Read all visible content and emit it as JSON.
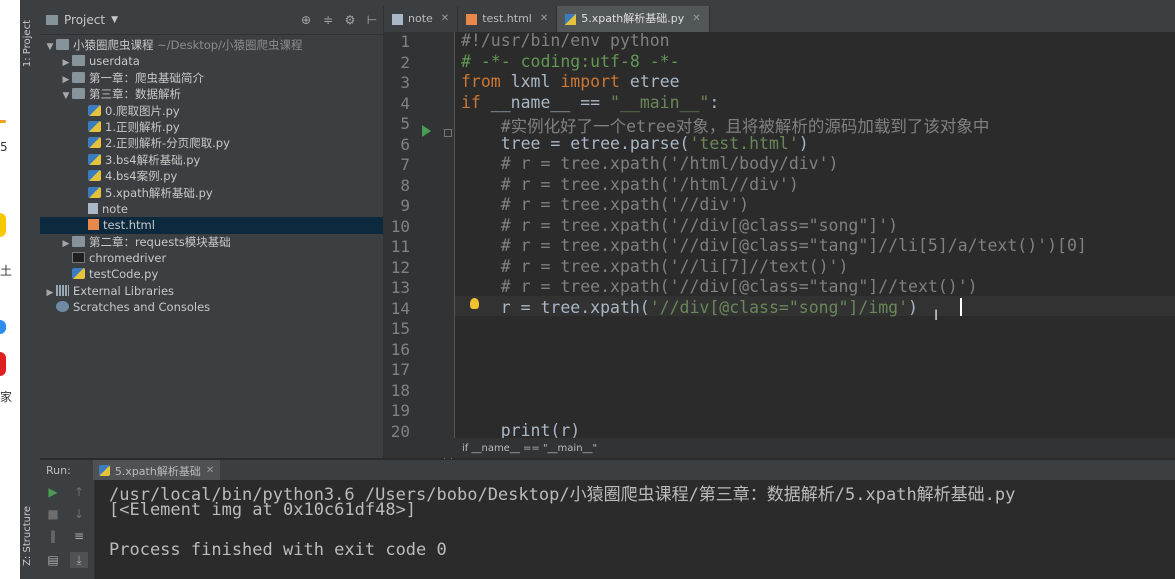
{
  "edge_window": {
    "labels": [
      "5",
      "土",
      "家"
    ]
  },
  "stripes": {
    "project": "1: Project",
    "structure": "Z: Structure"
  },
  "project_panel": {
    "title": "Project",
    "tree": [
      {
        "label": "小猿圈爬虫课程",
        "suffix": "~/Desktop/小猿圈爬虫课程",
        "depth": 0,
        "arrow": "▼",
        "icon": "folder"
      },
      {
        "label": "userdata",
        "depth": 1,
        "arrow": "▶",
        "icon": "folder"
      },
      {
        "label": "第一章：爬虫基础简介",
        "depth": 1,
        "arrow": "▶",
        "icon": "folder"
      },
      {
        "label": "第三章：数据解析",
        "depth": 1,
        "arrow": "▼",
        "icon": "folder"
      },
      {
        "label": "0.爬取图片.py",
        "depth": 2,
        "arrow": "",
        "icon": "py"
      },
      {
        "label": "1.正则解析.py",
        "depth": 2,
        "arrow": "",
        "icon": "py"
      },
      {
        "label": "2.正则解析-分页爬取.py",
        "depth": 2,
        "arrow": "",
        "icon": "py"
      },
      {
        "label": "3.bs4解析基础.py",
        "depth": 2,
        "arrow": "",
        "icon": "py"
      },
      {
        "label": "4.bs4案例.py",
        "depth": 2,
        "arrow": "",
        "icon": "py"
      },
      {
        "label": "5.xpath解析基础.py",
        "depth": 2,
        "arrow": "",
        "icon": "py"
      },
      {
        "label": "note",
        "depth": 2,
        "arrow": "",
        "icon": "file"
      },
      {
        "label": "test.html",
        "depth": 2,
        "arrow": "",
        "icon": "html",
        "selected": true
      },
      {
        "label": "第二章：requests模块基础",
        "depth": 1,
        "arrow": "▶",
        "icon": "folder"
      },
      {
        "label": "chromedriver",
        "depth": 1,
        "arrow": "",
        "icon": "exe"
      },
      {
        "label": "testCode.py",
        "depth": 1,
        "arrow": "",
        "icon": "py"
      },
      {
        "label": "External Libraries",
        "depth": 0,
        "arrow": "▶",
        "icon": "lib"
      },
      {
        "label": "Scratches and Consoles",
        "depth": 0,
        "arrow": "",
        "icon": "scratch"
      }
    ]
  },
  "tabs": [
    {
      "label": "note",
      "icon": "file",
      "active": false
    },
    {
      "label": "test.html",
      "icon": "html",
      "active": false
    },
    {
      "label": "5.xpath解析基础.py",
      "icon": "py",
      "active": true
    }
  ],
  "editor": {
    "line_numbers": [
      "1",
      "2",
      "3",
      "4",
      "5",
      "6",
      "7",
      "8",
      "9",
      "10",
      "11",
      "12",
      "13",
      "14",
      "15",
      "16",
      "17",
      "18",
      "19",
      "20"
    ],
    "lines": [
      "#!/usr/bin/env python",
      "# -*- coding:utf-8 -*-",
      "from lxml import etree",
      "if __name__ == \"__main__\":",
      "    #实例化好了一个etree对象，且将被解析的源码加载到了该对象中",
      "    tree = etree.parse('test.html')",
      "    # r = tree.xpath('/html/body/div')",
      "    # r = tree.xpath('/html//div')",
      "    # r = tree.xpath('//div')",
      "    # r = tree.xpath('//div[@class=\"song\"]')",
      "    # r = tree.xpath('//div[@class=\"tang\"]//li[5]/a/text()')[0]",
      "    # r = tree.xpath('//li[7]//text()')",
      "    # r = tree.xpath('//div[@class=\"tang\"]//text()')",
      "    r = tree.xpath('//div[@class=\"song\"]/img')",
      "",
      "",
      "",
      "",
      "",
      "    print(r)"
    ],
    "breadcrumb": "if __name__ == \"__main__\""
  },
  "run_panel": {
    "label": "Run:",
    "tab": "5.xpath解析基础",
    "output": [
      "/usr/local/bin/python3.6 /Users/bobo/Desktop/小猿圈爬虫课程/第三章：数据解析/5.xpath解析基础.py",
      "[<Element img at 0x10c61df48>]",
      "",
      "Process finished with exit code 0"
    ]
  },
  "colors": {
    "keyword": "#cc7832",
    "comment": "#808080",
    "string": "#6a8759",
    "doc_comment": "#629755",
    "run_green": "#499c54"
  }
}
